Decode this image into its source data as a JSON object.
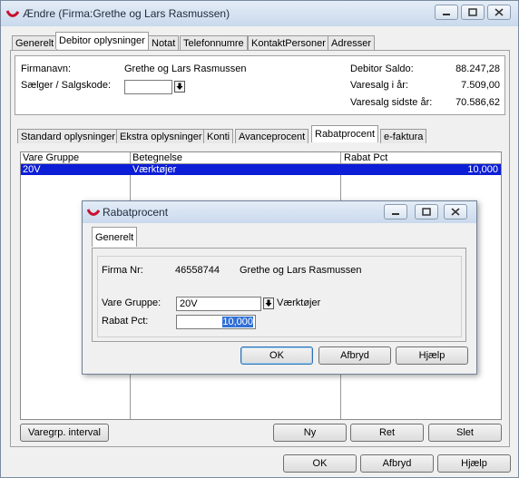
{
  "window": {
    "title": "Ændre  (Firma:Grethe og Lars Rasmussen)"
  },
  "top_tabs": [
    "Generelt",
    "Debitor oplysninger",
    "Notat",
    "Telefonnumre",
    "KontaktPersoner",
    "Adresser"
  ],
  "info": {
    "firmanavn_label": "Firmanavn:",
    "firmanavn_value": "Grethe og Lars Rasmussen",
    "saelger_label": "Sælger / Salgskode:",
    "saelger_value": "",
    "saldo_label": "Debitor Saldo:",
    "saldo_value": "88.247,28",
    "varesalg_label": "Varesalg i år:",
    "varesalg_value": "7.509,00",
    "varesalg_sidste_label": "Varesalg sidste år:",
    "varesalg_sidste_value": "70.586,62"
  },
  "sub_tabs": [
    "Standard oplysninger",
    "Ekstra oplysninger",
    "Konti",
    "Avanceprocent",
    "Rabatprocent",
    "e-faktura"
  ],
  "grid": {
    "columns": [
      "Vare Gruppe",
      "Betegnelse",
      "Rabat Pct"
    ],
    "rows": [
      {
        "gruppe": "20V",
        "betegnelse": "Værktøjer",
        "pct": "10,000"
      }
    ]
  },
  "bottom_buttons": {
    "varegrp": "Varegrp. interval",
    "ny": "Ny",
    "ret": "Ret",
    "slet": "Slet"
  },
  "footer_buttons": {
    "ok": "OK",
    "afbryd": "Afbryd",
    "hjaelp": "Hjælp"
  },
  "dialog": {
    "title": "Rabatprocent",
    "tab": "Generelt",
    "firma_nr_label": "Firma Nr:",
    "firma_nr_value": "46558744",
    "firma_navn_value": "Grethe og Lars Rasmussen",
    "vare_gruppe_label": "Vare Gruppe:",
    "vare_gruppe_value": "20V",
    "vare_gruppe_desc": "Værktøjer",
    "rabat_label": "Rabat Pct:",
    "rabat_value": "10,000",
    "ok": "OK",
    "afbryd": "Afbryd",
    "hjaelp": "Hjælp"
  },
  "colors": {
    "selection": "#0c1ed6",
    "titlebar": "#c9d9ec"
  }
}
